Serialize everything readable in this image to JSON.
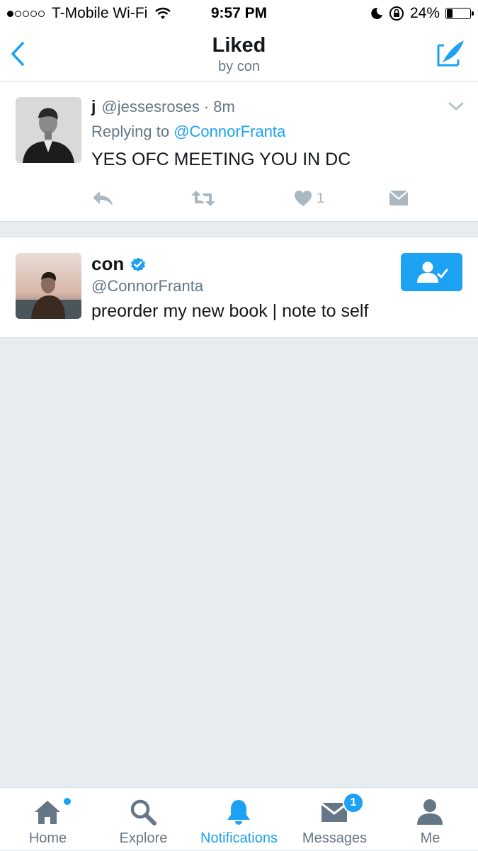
{
  "status_bar": {
    "carrier": "T-Mobile Wi-Fi",
    "time": "9:57 PM",
    "battery": "24%",
    "battery_level": 0.24,
    "icons": [
      "signal-dots-icon",
      "wifi-icon",
      "moon-icon",
      "rotation-lock-icon",
      "battery-icon"
    ]
  },
  "nav": {
    "title": "Liked",
    "subtitle": "by con",
    "back_icon": "back-chevron-icon",
    "compose_icon": "compose-tweet-icon"
  },
  "tweet": {
    "name": "j",
    "handle": "@jessesroses",
    "separator": "·",
    "time": "8m",
    "replying_prefix": "Replying to",
    "replying_handle": "@ConnorFranta",
    "text": "YES OFC MEETING YOU IN DC",
    "like_count": "1",
    "action_icons": [
      "reply-icon",
      "retweet-icon",
      "heart-icon",
      "direct-message-icon"
    ]
  },
  "user": {
    "name": "con",
    "handle": "@ConnorFranta",
    "bio": "preorder my new book | note to self",
    "verified": true,
    "follow_icon": "following-user-icon"
  },
  "tab_bar": {
    "tabs": [
      {
        "label": "Home",
        "icon": "home-icon"
      },
      {
        "label": "Explore",
        "icon": "search-icon"
      },
      {
        "label": "Notifications",
        "icon": "bell-icon"
      },
      {
        "label": "Messages",
        "icon": "envelope-icon",
        "badge": "1"
      },
      {
        "label": "Me",
        "icon": "person-icon"
      }
    ]
  },
  "colors": {
    "accent": "#1da1f2",
    "background": "#e6ecf0",
    "secondary_text": "#657786"
  }
}
